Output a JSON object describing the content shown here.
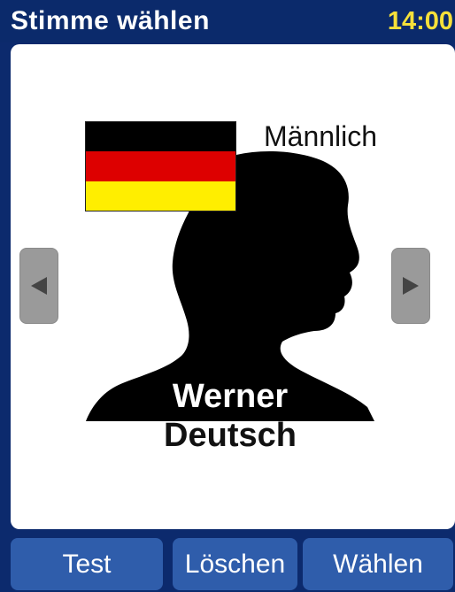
{
  "header": {
    "title": "Stimme wählen",
    "time": "14:00"
  },
  "voice": {
    "gender": "Männlich",
    "name": "Werner",
    "language": "Deutsch",
    "flag_colors": [
      "#000000",
      "#dd0000",
      "#ffee00"
    ]
  },
  "navigation": {
    "prev_icon": "left-arrow-icon",
    "next_icon": "right-arrow-icon"
  },
  "buttons": {
    "test": "Test",
    "delete": "Löschen",
    "select": "Wählen"
  },
  "colors": {
    "background": "#0c2a6d",
    "button": "#2f5dab",
    "clock": "#f5e03a"
  }
}
